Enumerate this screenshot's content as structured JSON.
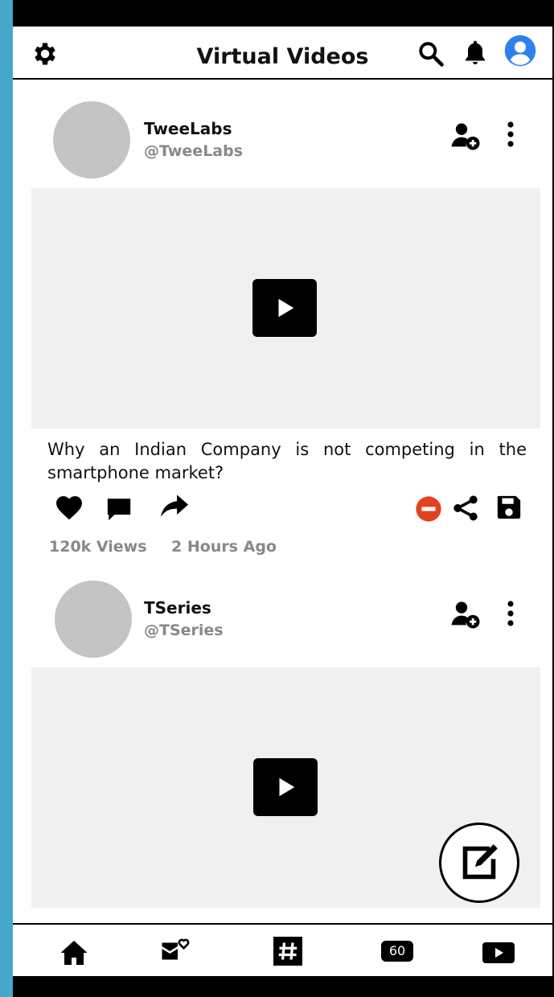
{
  "header": {
    "title": "Virtual Videos",
    "icons": [
      "gear-icon",
      "search-icon",
      "bell-icon",
      "user-avatar-icon"
    ]
  },
  "posts": [
    {
      "channel": "TweeLabs",
      "handle": "@TweeLabs",
      "caption": "Why an Indian Company is not competing in the smartphone market?",
      "views": "120k Views",
      "time": "2 Hours Ago"
    },
    {
      "channel": "TSeries",
      "handle": "@TSeries"
    }
  ],
  "bottom_nav": {
    "items": [
      "home-icon",
      "mail-heart-icon",
      "hashtag-icon",
      "sixty-badge",
      "play-icon"
    ],
    "sixty_label": "60"
  },
  "colors": {
    "background": "#45a7c9",
    "frame": "#000000",
    "avatar_placeholder": "#c4c4c4",
    "video_placeholder": "#f0f0f0",
    "remove_accent": "#e2431e",
    "muted_text": "#888888",
    "profile_accent": "#2f80ed"
  }
}
